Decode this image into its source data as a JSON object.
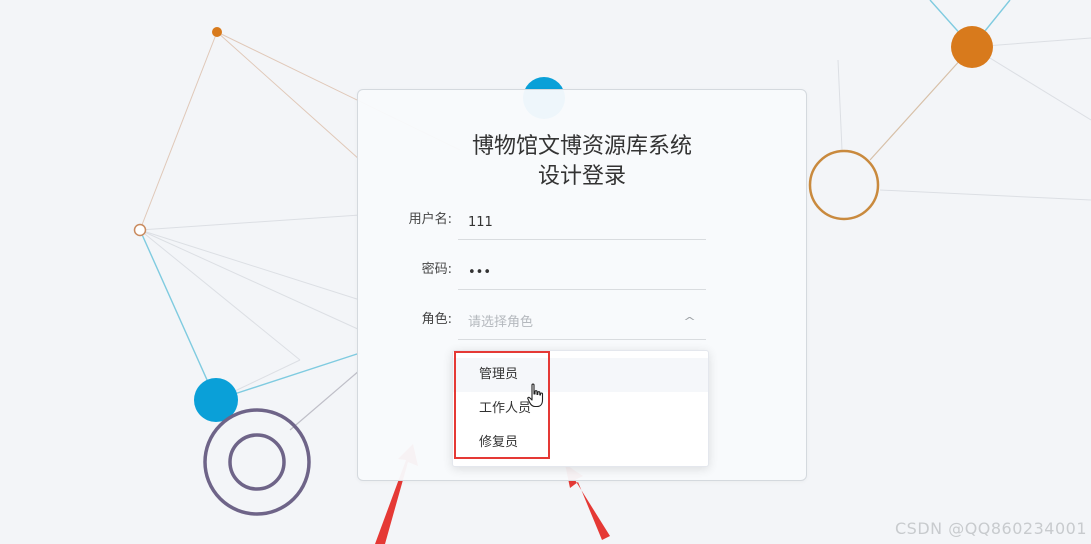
{
  "login": {
    "title_line1": "博物馆文博资源库系统",
    "title_line2": "设计登录",
    "username_label": "用户名:",
    "username_value": "111",
    "password_label": "密码:",
    "password_value": "111",
    "role_label": "角色:",
    "role_placeholder": "请选择角色"
  },
  "role_dropdown": {
    "options": [
      "管理员",
      "工作人员",
      "修复员"
    ],
    "hovered_option": "管理员"
  },
  "watermark": "CSDN @QQ860234001",
  "colors": {
    "node_blue": "#0aa0d8",
    "node_orange": "#d87a1c",
    "ring_purple": "#6e6488",
    "highlight_red": "#e53935"
  }
}
